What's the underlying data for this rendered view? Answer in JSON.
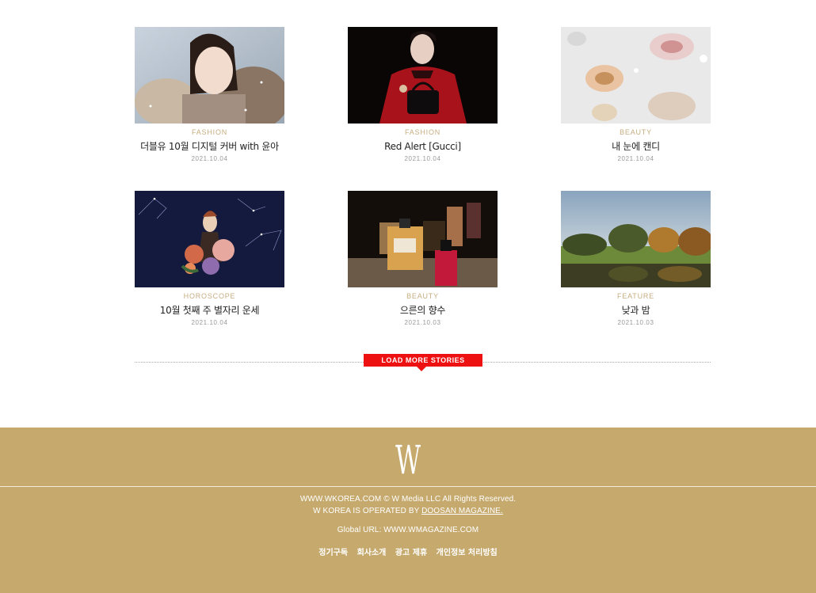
{
  "articles": [
    {
      "category": "FASHION",
      "title": "더블유 10월 디지털 커버 with 윤아",
      "date": "2021.10.04"
    },
    {
      "category": "FASHION",
      "title": "Red Alert [Gucci]",
      "date": "2021.10.04"
    },
    {
      "category": "BEAUTY",
      "title": "내 눈에 캔디",
      "date": "2021.10.04"
    },
    {
      "category": "HOROSCOPE",
      "title": "10월 첫째 주 별자리 운세",
      "date": "2021.10.04"
    },
    {
      "category": "BEAUTY",
      "title": "으른의 향수",
      "date": "2021.10.03"
    },
    {
      "category": "FEATURE",
      "title": "낮과 밤",
      "date": "2021.10.03"
    }
  ],
  "load_more_label": "LOAD MORE STORIES",
  "footer": {
    "logo": "W",
    "copyright": "WWW.WKOREA.COM © W Media LLC All Rights Reserved.",
    "operated_prefix": "W KOREA IS OPERATED BY ",
    "operated_link": "DOOSAN MAGAZINE.",
    "global_label": "Global URL: ",
    "global_url": "WWW.WMAGAZINE.COM",
    "links": [
      "정기구독",
      "회사소개",
      "광고 제휴",
      "개인정보 처리방침"
    ]
  },
  "colors": {
    "accent": "#ee1111",
    "footer_bg": "#c6a96d",
    "category": "#c7ad80"
  }
}
